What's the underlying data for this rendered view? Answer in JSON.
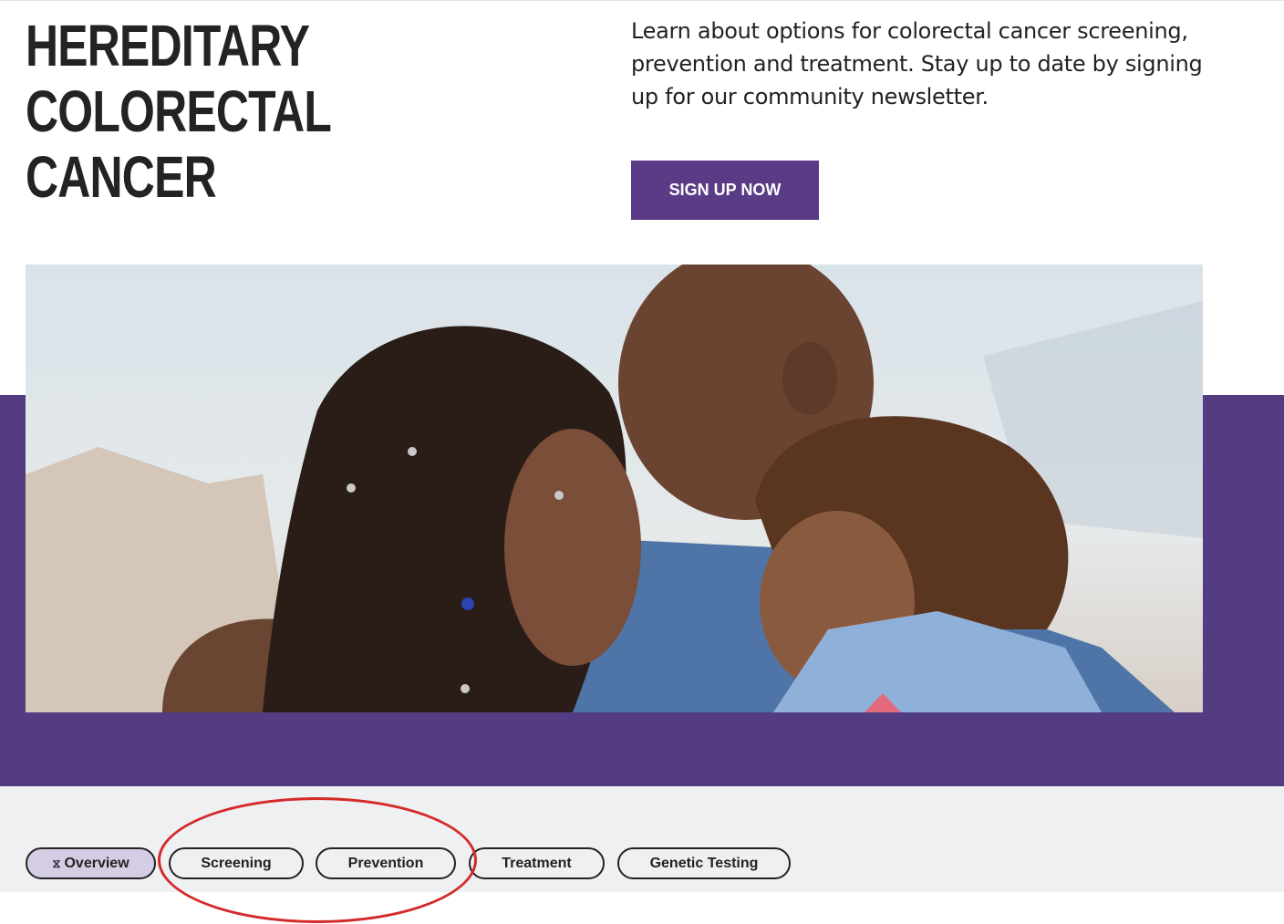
{
  "header": {
    "title_line1": "HEREDITARY COLORECTAL",
    "title_line2": "CANCER",
    "intro": "Learn about options for colorectal cancer screening, prevention and treatment. Stay up to date by signing up for our community newsletter.",
    "signup_label": "SIGN UP NOW"
  },
  "hero": {
    "image": "family-photo"
  },
  "tabs": [
    {
      "label": "Overview",
      "active": true
    },
    {
      "label": "Screening",
      "active": false
    },
    {
      "label": "Prevention",
      "active": false
    },
    {
      "label": "Treatment",
      "active": false
    },
    {
      "label": "Genetic Testing",
      "active": false
    }
  ],
  "colors": {
    "brand_purple": "#543c82",
    "button_purple": "#5a3b85",
    "active_tab": "#d5cde3",
    "annotation_red": "#d42a2a"
  }
}
